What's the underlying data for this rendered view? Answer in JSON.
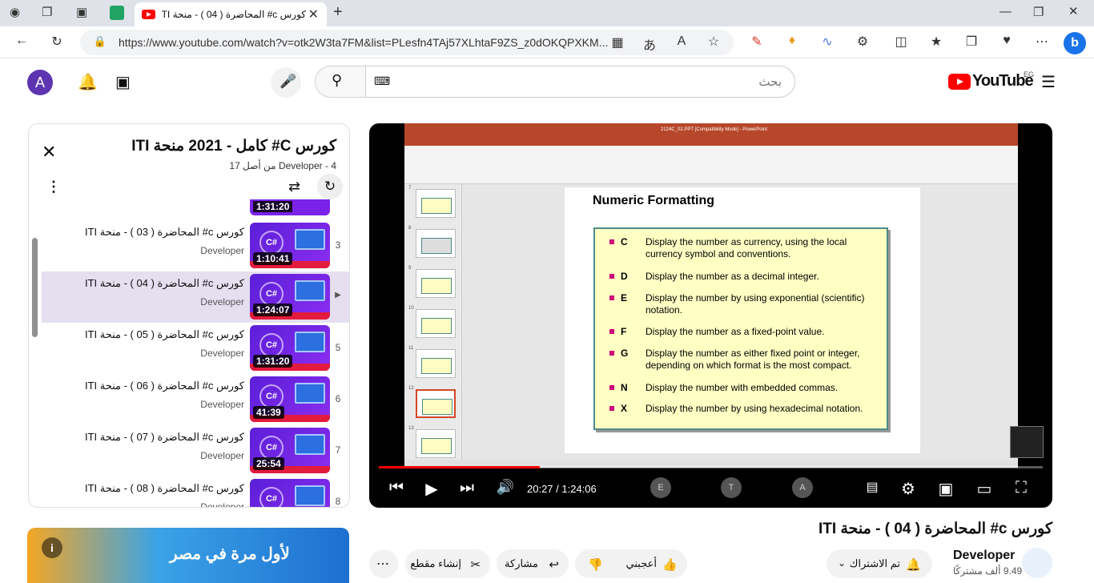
{
  "browser": {
    "tab_title": "كورس c# المحاضرة ( 04 ) - منحة ITI",
    "url": "https://www.youtube.com/watch?v=otk2W3ta7FM&list=PLesfn4TAj57XLhtaF9ZS_z0dOKQPXKM..."
  },
  "header": {
    "avatar_letter": "A",
    "search_placeholder": "بحث",
    "logo_text": "YouTube",
    "region": "EG"
  },
  "playlist": {
    "title": "كورس C# كامل - 2021 منحة ITI",
    "subtitle": "Developer - 4 من أصل 17",
    "items": [
      {
        "index": "3",
        "title": "كورس c# المحاضرة ( 03 ) - منحة ITI",
        "channel": "Developer",
        "duration": "1:10:41",
        "active": false
      },
      {
        "index": "▶",
        "title": "كورس c# المحاضرة ( 04 ) - منحة ITI",
        "channel": "Developer",
        "duration": "1:24:07",
        "active": true
      },
      {
        "index": "5",
        "title": "كورس c# المحاضرة ( 05 ) - منحة ITI",
        "channel": "Developer",
        "duration": "1:31:20",
        "active": false
      },
      {
        "index": "6",
        "title": "كورس c# المحاضرة ( 06 ) - منحة ITI",
        "channel": "Developer",
        "duration": "41:39",
        "active": false
      },
      {
        "index": "7",
        "title": "كورس c# المحاضرة ( 07 ) - منحة ITI",
        "channel": "Developer",
        "duration": "25:54",
        "active": false
      },
      {
        "index": "8",
        "title": "كورس c# المحاضرة ( 08 ) - منحة ITI",
        "channel": "Developer",
        "duration": "",
        "active": false
      }
    ],
    "partial_top_duration": "1:31:20"
  },
  "video": {
    "ppt_title": "2124C_02.PPT [Compatibility Mode] - PowerPoint",
    "slide_heading": "Numeric Formatting",
    "slide_rows": [
      {
        "key": "C",
        "text": "Display the number as currency, using the local currency symbol and conventions."
      },
      {
        "key": "D",
        "text": "Display the number as a decimal integer."
      },
      {
        "key": "E",
        "text": "Display the number by using exponential (scientific) notation."
      },
      {
        "key": "F",
        "text": "Display the number as a fixed-point value."
      },
      {
        "key": "G",
        "text": "Display the number as either fixed point or integer, depending on which format is the most compact."
      },
      {
        "key": "N",
        "text": "Display the number with embedded commas."
      },
      {
        "key": "X",
        "text": "Display the number by using hexadecimal notation."
      }
    ],
    "slide_numbers": [
      "7",
      "8",
      "9",
      "10",
      "11",
      "12",
      "13"
    ],
    "time_current": "20:27",
    "time_total": "1:24:06",
    "progress": 0.243,
    "participants": [
      "E",
      "T",
      "A"
    ]
  },
  "below": {
    "video_title": "كورس c# المحاضرة ( 04 ) - منحة ITI",
    "channel_name": "Developer",
    "subscribers": "9.49 ألف مشتركًا",
    "subscribed_label": "تم الاشتراك",
    "like_label": "أعجبني",
    "share_label": "مشاركة",
    "clip_label": "إنشاء مقطع",
    "ad_text": "لأول مرة في مصر"
  }
}
